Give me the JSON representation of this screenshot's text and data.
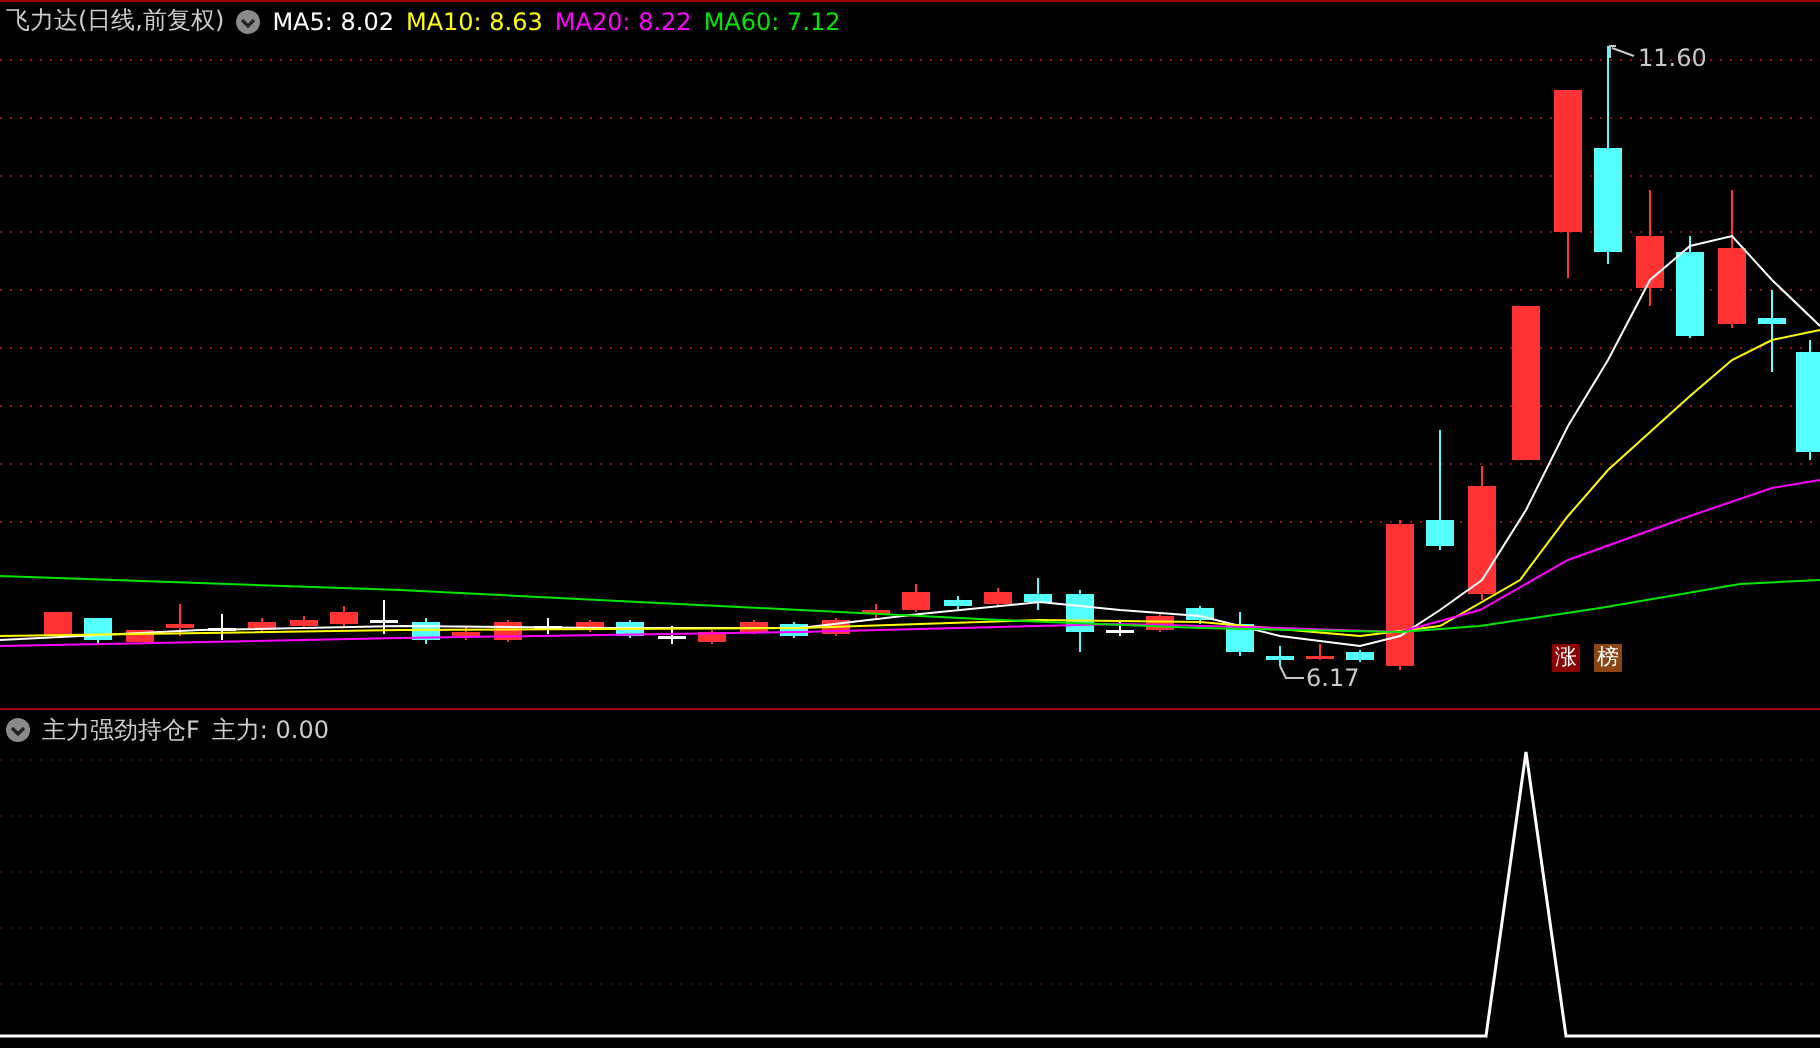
{
  "main_panel": {
    "title": "飞力达(日线,前复权)",
    "legend": [
      {
        "label": "MA5: 8.02",
        "color": "#ffffff"
      },
      {
        "label": "MA10: 8.63",
        "color": "#ffff00"
      },
      {
        "label": "MA20: 8.22",
        "color": "#ff00ff"
      },
      {
        "label": "MA60: 7.12",
        "color": "#00e600"
      }
    ],
    "high_label": "11.60",
    "low_label": "6.17",
    "badges": [
      {
        "label": "涨",
        "color": "#8b0000"
      },
      {
        "label": "榜",
        "color": "#8b4513"
      }
    ]
  },
  "indicator_panel": {
    "title": "主力强劲持仓F",
    "reading": "主力: 0.00"
  }
}
